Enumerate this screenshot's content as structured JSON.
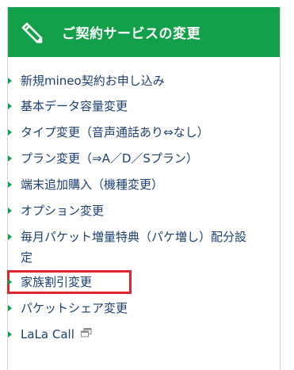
{
  "header": {
    "title": "ご契約サービスの変更",
    "icon": "pencil-edit-icon",
    "background_color": "#12a14a"
  },
  "menu": {
    "items": [
      {
        "label": "新規mineo契約お申し込み"
      },
      {
        "label": "基本データ容量変更"
      },
      {
        "label": "タイプ変更（音声通話あり⇔なし）"
      },
      {
        "label": "プラン変更（⇒A／D／Sプラン）"
      },
      {
        "label": "端末追加購入（機種変更）"
      },
      {
        "label": "オプション変更"
      },
      {
        "label": "毎月パケット増量特典（パケ増し）配分設定"
      },
      {
        "label": "家族割引変更",
        "highlighted": true
      },
      {
        "label": "パケットシェア変更"
      },
      {
        "label": "LaLa Call",
        "icon": "external-window-icon"
      }
    ]
  },
  "colors": {
    "link": "#1a3f74",
    "bullet": "#12a14a",
    "highlight_border": "#e0242b"
  }
}
